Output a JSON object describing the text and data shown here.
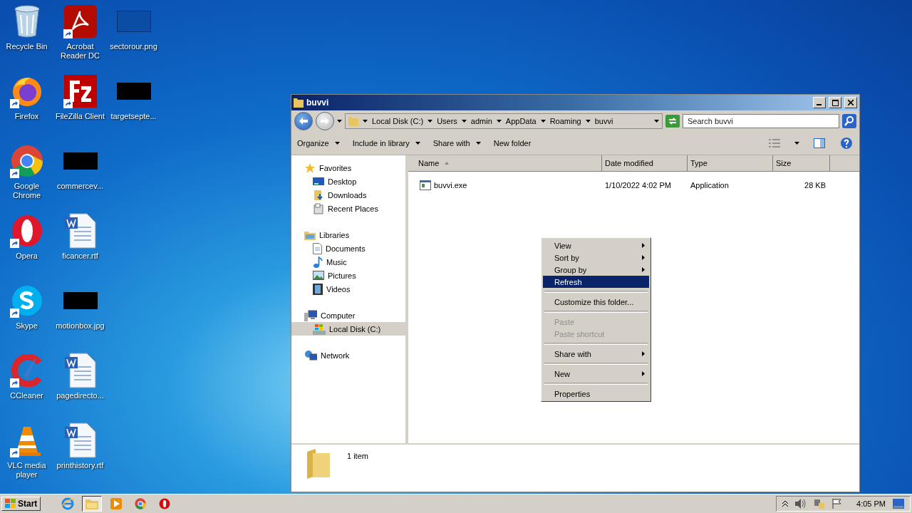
{
  "desktop_columns": [
    [
      {
        "label": "Recycle Bin",
        "kind": "recycle",
        "shortcut": false
      },
      {
        "label": "Firefox",
        "kind": "firefox",
        "shortcut": true
      },
      {
        "label": "Google Chrome",
        "kind": "chrome",
        "shortcut": true
      },
      {
        "label": "Opera",
        "kind": "opera",
        "shortcut": true
      },
      {
        "label": "Skype",
        "kind": "skype",
        "shortcut": true
      },
      {
        "label": "CCleaner",
        "kind": "ccleaner",
        "shortcut": true
      },
      {
        "label": "VLC media player",
        "kind": "vlc",
        "shortcut": true
      }
    ],
    [
      {
        "label": "Acrobat Reader DC",
        "kind": "acrobat",
        "shortcut": true
      },
      {
        "label": "FileZilla Client",
        "kind": "filezilla",
        "shortcut": true
      },
      {
        "label": "commercev...",
        "kind": "thumbnail",
        "shortcut": false
      },
      {
        "label": "ficancer.rtf",
        "kind": "word",
        "shortcut": false
      },
      {
        "label": "motionbox.jpg",
        "kind": "thumbnail",
        "shortcut": false
      },
      {
        "label": "pagedirecto...",
        "kind": "word",
        "shortcut": false
      },
      {
        "label": "printhistory.rtf",
        "kind": "word",
        "shortcut": false
      }
    ],
    [
      {
        "label": "sectorour.png",
        "kind": "outline",
        "shortcut": false
      },
      {
        "label": "targetsepte...",
        "kind": "thumbnail",
        "shortcut": false
      }
    ]
  ],
  "window": {
    "title": "buvvi",
    "address": [
      "Local Disk (C:)",
      "Users",
      "admin",
      "AppData",
      "Roaming",
      "buvvi"
    ],
    "search": {
      "placeholder": "Search buvvi"
    },
    "toolbar": [
      {
        "label": "Organize",
        "dropdown": true
      },
      {
        "label": "Include in library",
        "dropdown": true
      },
      {
        "label": "Share with",
        "dropdown": true
      },
      {
        "label": "New folder",
        "dropdown": false
      }
    ],
    "nav": [
      {
        "label": "Favorites",
        "kind": "star",
        "selected": false,
        "children": [
          {
            "label": "Desktop",
            "kind": "desktop",
            "selected": false
          },
          {
            "label": "Downloads",
            "kind": "downloads",
            "selected": false
          },
          {
            "label": "Recent Places",
            "kind": "recent",
            "selected": false
          }
        ]
      },
      {
        "label": "Libraries",
        "kind": "libraries",
        "selected": false,
        "children": [
          {
            "label": "Documents",
            "kind": "documents",
            "selected": false
          },
          {
            "label": "Music",
            "kind": "music",
            "selected": false
          },
          {
            "label": "Pictures",
            "kind": "pictures",
            "selected": false
          },
          {
            "label": "Videos",
            "kind": "videos",
            "selected": false
          }
        ]
      },
      {
        "label": "Computer",
        "kind": "computer",
        "selected": false,
        "children": [
          {
            "label": "Local Disk (C:)",
            "kind": "disk",
            "selected": true
          }
        ]
      },
      {
        "label": "Network",
        "kind": "network",
        "selected": false
      }
    ],
    "columns": [
      {
        "label": "Name",
        "sorted": true
      },
      {
        "label": "Date modified",
        "sorted": false
      },
      {
        "label": "Type",
        "sorted": false
      },
      {
        "label": "Size",
        "sorted": false
      }
    ],
    "rows": [
      {
        "name": "buvvi.exe",
        "date": "1/10/2022 4:02 PM",
        "type": "Application",
        "size": "28 KB"
      }
    ],
    "status": "1 item"
  },
  "context_menu": [
    {
      "kind": "item",
      "label": "View",
      "submenu": true,
      "disabled": false,
      "selected": false
    },
    {
      "kind": "item",
      "label": "Sort by",
      "submenu": true,
      "disabled": false,
      "selected": false
    },
    {
      "kind": "item",
      "label": "Group by",
      "submenu": true,
      "disabled": false,
      "selected": false
    },
    {
      "kind": "item",
      "label": "Refresh",
      "submenu": false,
      "disabled": false,
      "selected": true
    },
    {
      "kind": "separator"
    },
    {
      "kind": "item",
      "label": "Customize this folder...",
      "submenu": false,
      "disabled": false,
      "selected": false
    },
    {
      "kind": "separator"
    },
    {
      "kind": "item",
      "label": "Paste",
      "submenu": false,
      "disabled": true,
      "selected": false
    },
    {
      "kind": "item",
      "label": "Paste shortcut",
      "submenu": false,
      "disabled": true,
      "selected": false
    },
    {
      "kind": "separator"
    },
    {
      "kind": "item",
      "label": "Share with",
      "submenu": true,
      "disabled": false,
      "selected": false
    },
    {
      "kind": "separator"
    },
    {
      "kind": "item",
      "label": "New",
      "submenu": true,
      "disabled": false,
      "selected": false
    },
    {
      "kind": "separator"
    },
    {
      "kind": "item",
      "label": "Properties",
      "submenu": false,
      "disabled": false,
      "selected": false
    }
  ],
  "taskbar": {
    "start": "Start",
    "apps": [
      {
        "kind": "ie",
        "active": false
      },
      {
        "kind": "explorer",
        "active": true
      },
      {
        "kind": "media",
        "active": false
      },
      {
        "kind": "chrome",
        "active": false
      },
      {
        "kind": "opera",
        "active": false
      }
    ],
    "time": "4:05 PM"
  }
}
